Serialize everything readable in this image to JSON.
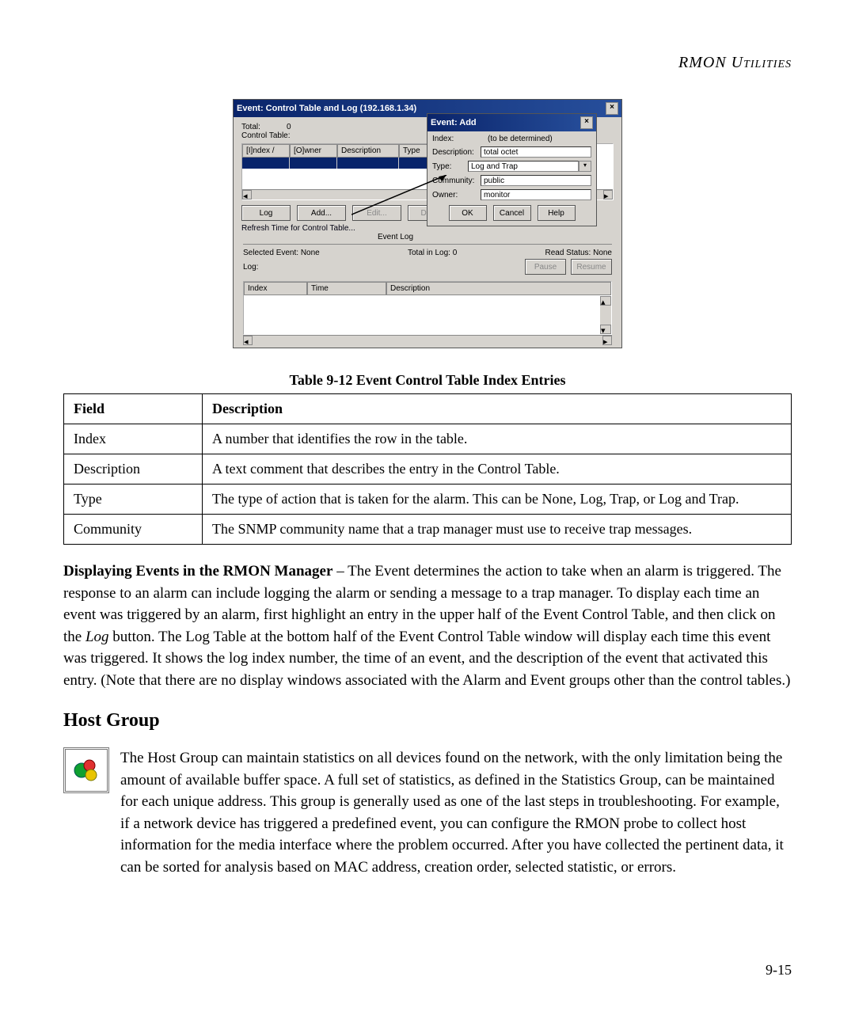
{
  "header": {
    "title": "RMON Utilities"
  },
  "screenshot": {
    "main_window": {
      "title": "Event: Control Table and Log (192.168.1.34)",
      "total_label": "Total:",
      "total_value": "0",
      "control_label": "Control Table:",
      "columns": {
        "index": "[I]ndex  /",
        "owner": "[O]wner",
        "desc": "Description",
        "type": "Type"
      },
      "buttons": {
        "log": "Log",
        "add": "Add...",
        "edit": "Edit...",
        "delete": "Delete"
      },
      "refresh": "Refresh Time for Control Table...",
      "event_log_label": "Event Log",
      "sel_event": "Selected Event:  None",
      "total_in_log": "Total in Log:  0",
      "read_status": "Read Status:   None",
      "pause": "Pause",
      "resume": "Resume",
      "log_label": "Log:",
      "log_columns": {
        "index": "Index",
        "time": "Time",
        "desc": "Description"
      }
    },
    "popup": {
      "title": "Event: Add",
      "index_label": "Index:",
      "index_value": "(to be determined)",
      "desc_label": "Description:",
      "desc_value": "total octet",
      "type_label": "Type:",
      "type_value": "Log and Trap",
      "community_label": "Community:",
      "community_value": "public",
      "owner_label": "Owner:",
      "owner_value": "monitor",
      "ok": "OK",
      "cancel": "Cancel",
      "help": "Help"
    }
  },
  "caption": "Table 9-12  Event Control Table Index Entries",
  "table": {
    "head": {
      "field": "Field",
      "desc": "Description"
    },
    "rows": [
      {
        "field": "Index",
        "desc": "A number that identifies the row in the table."
      },
      {
        "field": "Description",
        "desc": "A text comment that describes the entry in the Control Table."
      },
      {
        "field": "Type",
        "desc": "The type of action that is taken for the alarm. This can be None, Log, Trap, or Log and Trap."
      },
      {
        "field": "Community",
        "desc": "The SNMP community name that a trap manager must use to receive trap messages."
      }
    ]
  },
  "para1": {
    "lead": "Displaying Events in the RMON Manager",
    "body_a": " – The Event determines the action to take when an alarm is triggered. The response to an alarm can include logging the alarm or sending a message to a trap manager. To display each time an event was triggered by an alarm, first highlight an entry in the upper half of the Event Control Table, and then click on the ",
    "log_word": "Log",
    "body_b": " button. The Log Table at the bottom half of the Event Control Table window will display each time this event was triggered. It shows the log index number, the time of an event, and the description of the event that activated this entry. (Note that there are no display windows associated with the Alarm and Event groups other than the control tables.)"
  },
  "section": {
    "heading": "Host Group"
  },
  "para2": {
    "body": "The Host Group can maintain statistics on all devices found on the network, with the only limitation being the amount of available buffer space. A full set of statistics, as defined in the Statistics Group, can be maintained for each unique address. This group is generally used as one of the last steps in troubleshooting. For example, if a network device has triggered a predefined event, you can configure the RMON probe to collect host information for the media interface where the problem occurred. After you have collected the pertinent data, it can be sorted for analysis based on MAC address, creation order, selected statistic, or errors."
  },
  "page_number": "9-15"
}
